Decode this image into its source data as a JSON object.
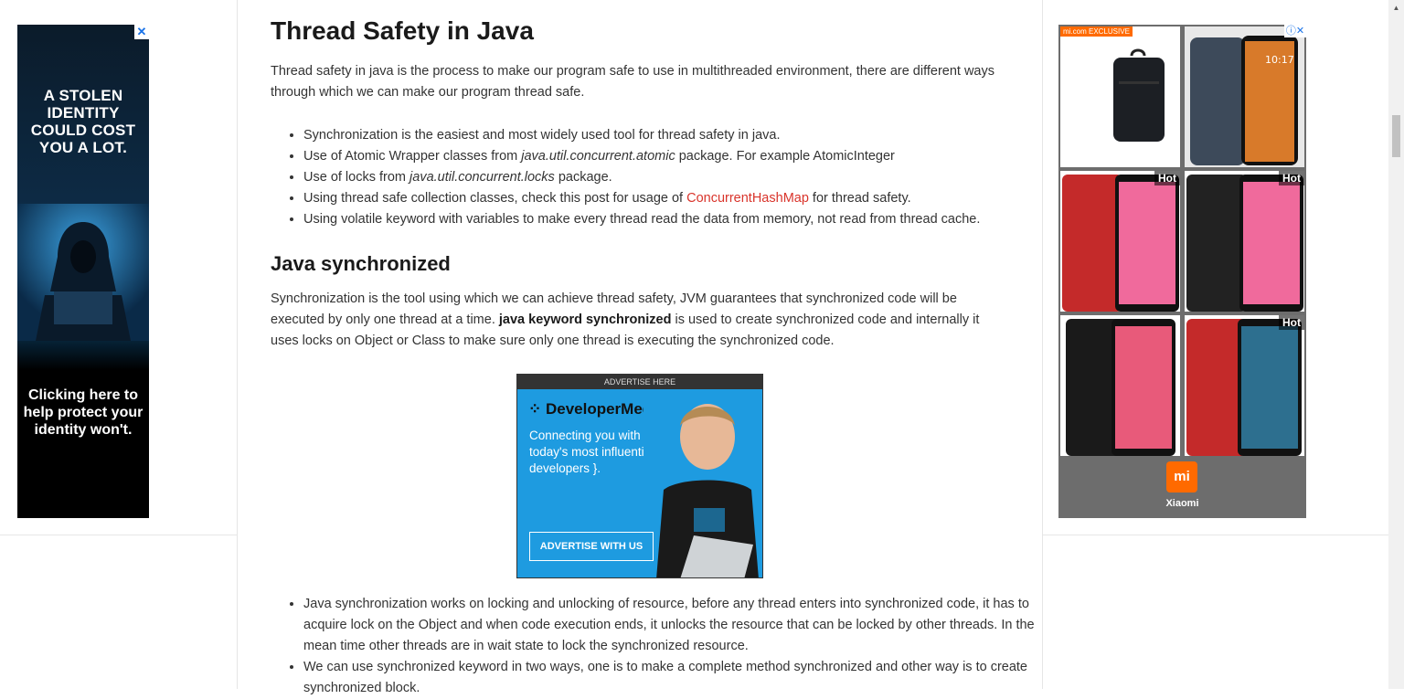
{
  "left_ad": {
    "close": "✕",
    "headline": "A STOLEN IDENTITY COULD COST YOU A LOT.",
    "tagline": "Clicking here to help protect your identity won't."
  },
  "article": {
    "title": "Thread Safety in Java",
    "intro": "Thread safety in java is the process to make our program safe to use in multithreaded environment, there are different ways through which we can make our program thread safe.",
    "bullets1": [
      {
        "pre": "Synchronization is the easiest and most widely used tool for thread safety in java.",
        "em": "",
        "post": ""
      },
      {
        "pre": "Use of Atomic Wrapper classes from ",
        "em": "java.util.concurrent.atomic",
        "post": " package. For example AtomicInteger"
      },
      {
        "pre": "Use of locks from ",
        "em": "java.util.concurrent.locks",
        "post": " package."
      },
      {
        "pre": "Using thread safe collection classes, check this post for usage of ",
        "link": "ConcurrentHashMap",
        "post": " for thread safety."
      },
      {
        "pre": "Using volatile keyword with variables to make every thread read the data from memory, not read from thread cache.",
        "em": "",
        "post": ""
      }
    ],
    "section2_title": "Java synchronized",
    "para2_pre": "Synchronization is the tool using which we can achieve thread safety, JVM guarantees that synchronized code will be executed by only one thread at a time. ",
    "para2_bold": "java keyword synchronized",
    "para2_post": " is used to create synchronized code and internally it uses locks on Object or Class to make sure only one thread is executing the synchronized code.",
    "bullets2": [
      "Java synchronization works on locking and unlocking of resource, before any thread enters into synchronized code, it has to acquire lock on the Object and when code execution ends, it unlocks the resource that can be locked by other threads. In the mean time other threads are in wait state to lock the synchronized resource.",
      "We can use synchronized keyword in two ways, one is to make a complete method synchronized and other way is to create synchronized block."
    ]
  },
  "mid_ad": {
    "top": "ADVERTISE HERE",
    "brand": "DeveloperMedia",
    "tagline": "Connecting you with today's most influential { developers }.",
    "button": "ADVERTISE WITH US"
  },
  "right_ad": {
    "badge": "mi.com  EXCLUSIVE",
    "close": "ⓘ✕",
    "hot_label": "Hot",
    "brand": "Xiaomi",
    "logo": "mi"
  },
  "colors": {
    "link": "#d9342b",
    "mi_orange": "#ff6a00",
    "dm_blue": "#1e9be0"
  }
}
